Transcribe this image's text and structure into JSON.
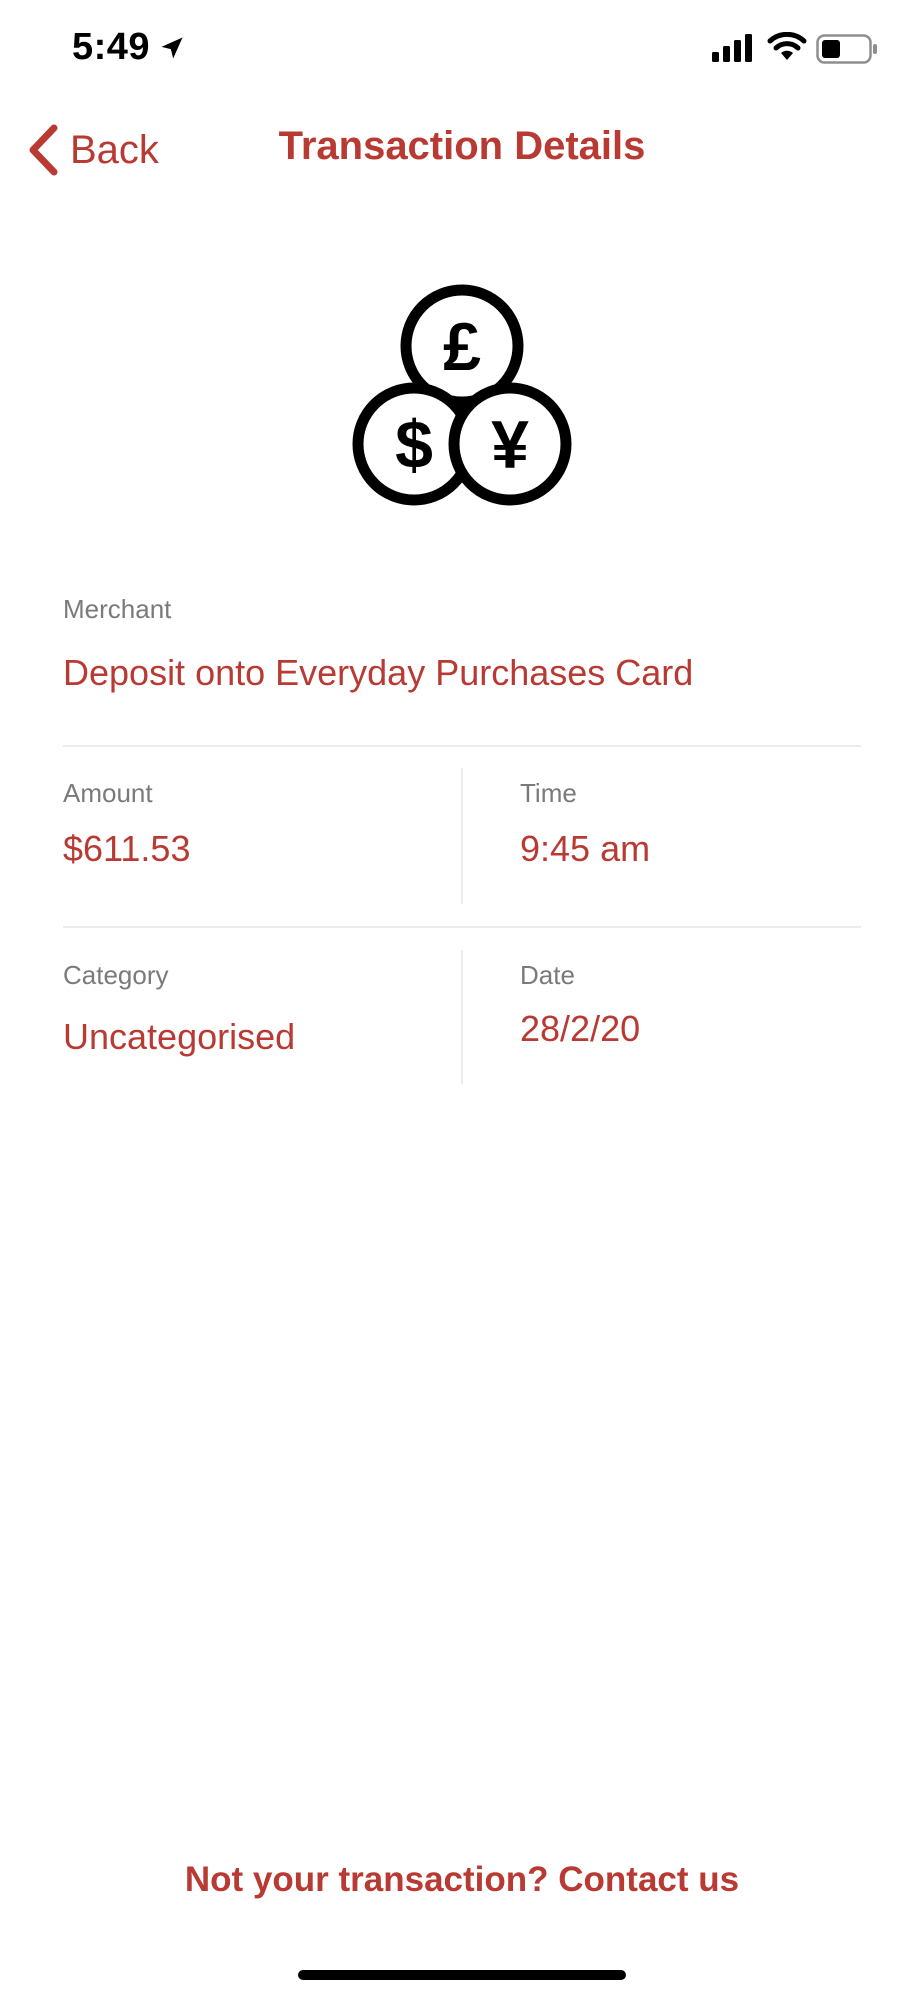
{
  "status_bar": {
    "time": "5:49",
    "icons": [
      "location-arrow-icon",
      "cellular-signal-icon",
      "wifi-icon",
      "battery-icon"
    ]
  },
  "nav": {
    "back_label": "Back",
    "title": "Transaction Details"
  },
  "hero_icon": "currency-coins-icon",
  "merchant": {
    "label": "Merchant",
    "value": "Deposit onto Everyday Purchases Card"
  },
  "amount": {
    "label": "Amount",
    "value": "$611.53"
  },
  "time": {
    "label": "Time",
    "value": "9:45 am"
  },
  "category": {
    "label": "Category",
    "value": "Uncategorised"
  },
  "date": {
    "label": "Date",
    "value": "28/2/20"
  },
  "contact_link": "Not your transaction? Contact us",
  "colors": {
    "accent": "#b83a33",
    "label_gray": "#7a7a7a",
    "divider": "#ececec"
  }
}
